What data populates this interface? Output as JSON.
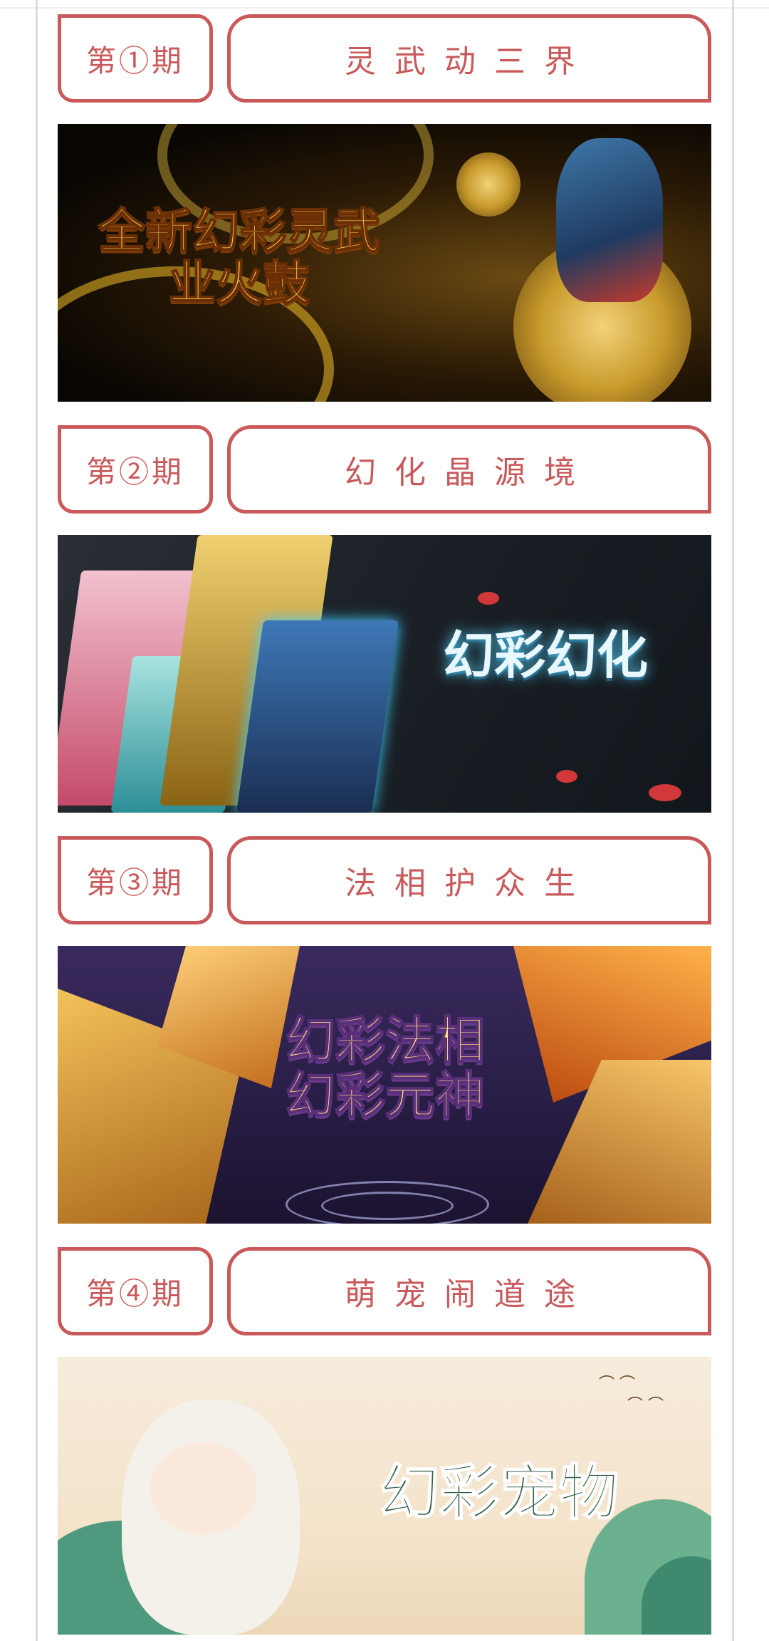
{
  "sections": [
    {
      "issue": "第①期",
      "title": "灵武动三界",
      "banner_text": "全新幻彩灵武\n业火鼓"
    },
    {
      "issue": "第②期",
      "title": "幻化晶源境",
      "banner_text": "幻彩幻化"
    },
    {
      "issue": "第③期",
      "title": "法相护众生",
      "banner_text": "幻彩法相\n幻彩元神"
    },
    {
      "issue": "第④期",
      "title": "萌宠闹道途",
      "banner_text": "幻彩宠物"
    }
  ],
  "colors": {
    "accent": "#c9595a",
    "background": "#ffffff",
    "rail": "#dcdcdc"
  }
}
